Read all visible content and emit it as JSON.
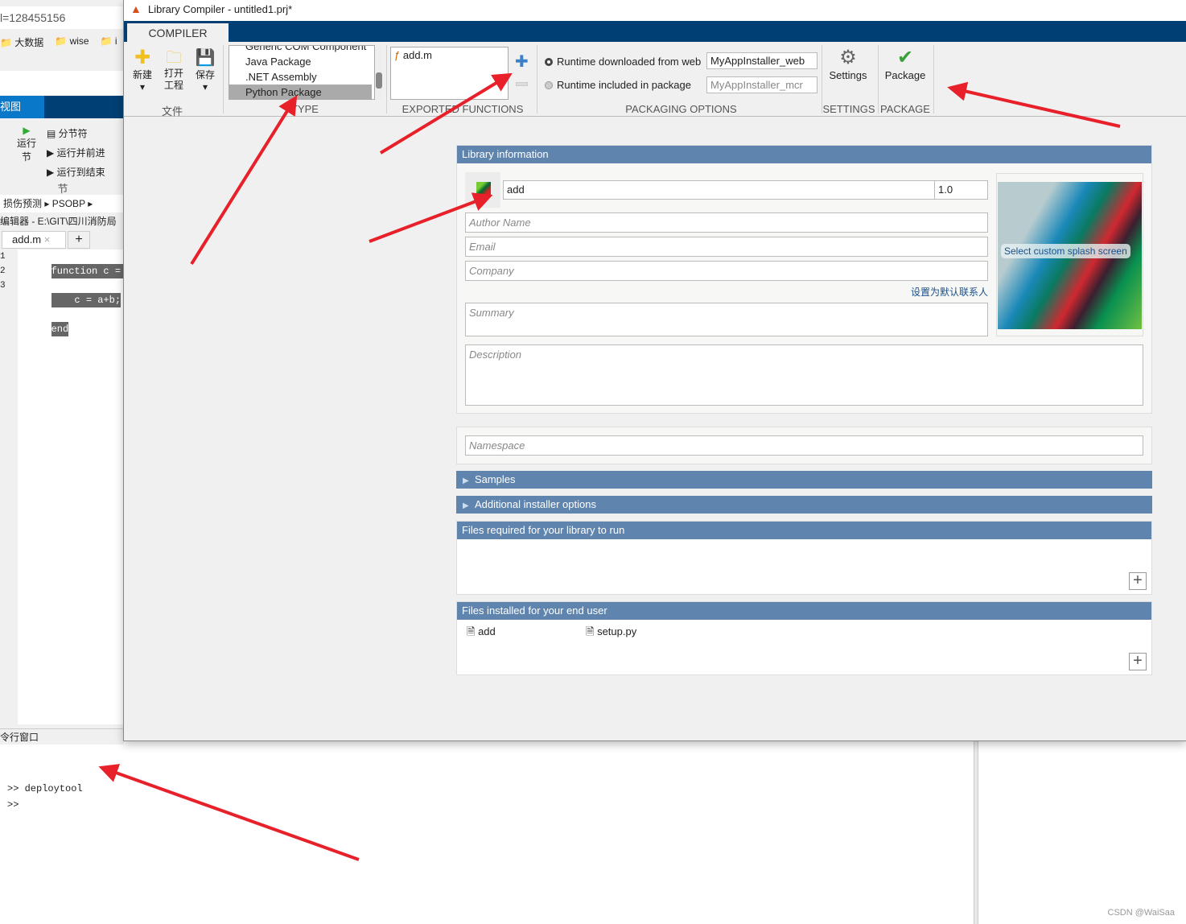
{
  "background": {
    "address_text": "l=128455156",
    "bookmarks": [
      "大数据",
      "wise",
      "i"
    ],
    "view_tab": "视图",
    "run_section_label": "运行\n节",
    "section_items": [
      "分节符",
      "运行并前进",
      "运行到结束"
    ],
    "section_group": "节",
    "breadcrumb": [
      "损伤预测",
      "PSOBP"
    ],
    "editor_title": "编辑器 - E:\\GIT\\四川消防局",
    "editor_tab": "add.m",
    "code_lines": [
      "function c = ad",
      "    c = a+b;",
      "end"
    ],
    "line_numbers": [
      "1",
      "2",
      "3"
    ],
    "command_window_title": "令行窗口",
    "command_lines": [
      ">> deploytool",
      ">>"
    ]
  },
  "dialog": {
    "title": "Library Compiler - untitled1.prj*",
    "tab": "COMPILER",
    "file_group": {
      "label": "文件",
      "buttons": [
        "新建",
        "打开\n工程",
        "保存"
      ]
    },
    "type_group": {
      "label": "TYPE",
      "items": [
        "Generic COM Component",
        "Java Package",
        ".NET Assembly",
        "Python Package"
      ],
      "selected": "Python Package"
    },
    "exported": {
      "label": "EXPORTED FUNCTIONS",
      "files": [
        "add.m"
      ]
    },
    "packaging": {
      "label": "PACKAGING OPTIONS",
      "option1": "Runtime downloaded from web",
      "value1": "MyAppInstaller_web",
      "option2": "Runtime included in package",
      "value2": "MyAppInstaller_mcr",
      "selected": "option1"
    },
    "settings": {
      "label": "SETTINGS",
      "button": "Settings"
    },
    "package": {
      "label": "PACKAGE",
      "button": "Package"
    },
    "library_info": {
      "header": "Library information",
      "name": "add",
      "version": "1.0",
      "author_placeholder": "Author Name",
      "email_placeholder": "Email",
      "company_placeholder": "Company",
      "default_contact_link": "设置为默认联系人",
      "summary_placeholder": "Summary",
      "description_placeholder": "Description",
      "splash_label": "Select custom splash screen"
    },
    "namespace_placeholder": "Namespace",
    "samples": "Samples",
    "installer_options": "Additional installer options",
    "files_required": "Files required for your library to run",
    "files_installed": {
      "header": "Files installed for your end user",
      "files": [
        "add",
        "setup.py"
      ]
    }
  },
  "watermark": "CSDN @WaiSaa",
  "colors": {
    "accent": "#003f73",
    "section_header": "#5f84ae",
    "annotation_arrow": "#e8202a"
  }
}
